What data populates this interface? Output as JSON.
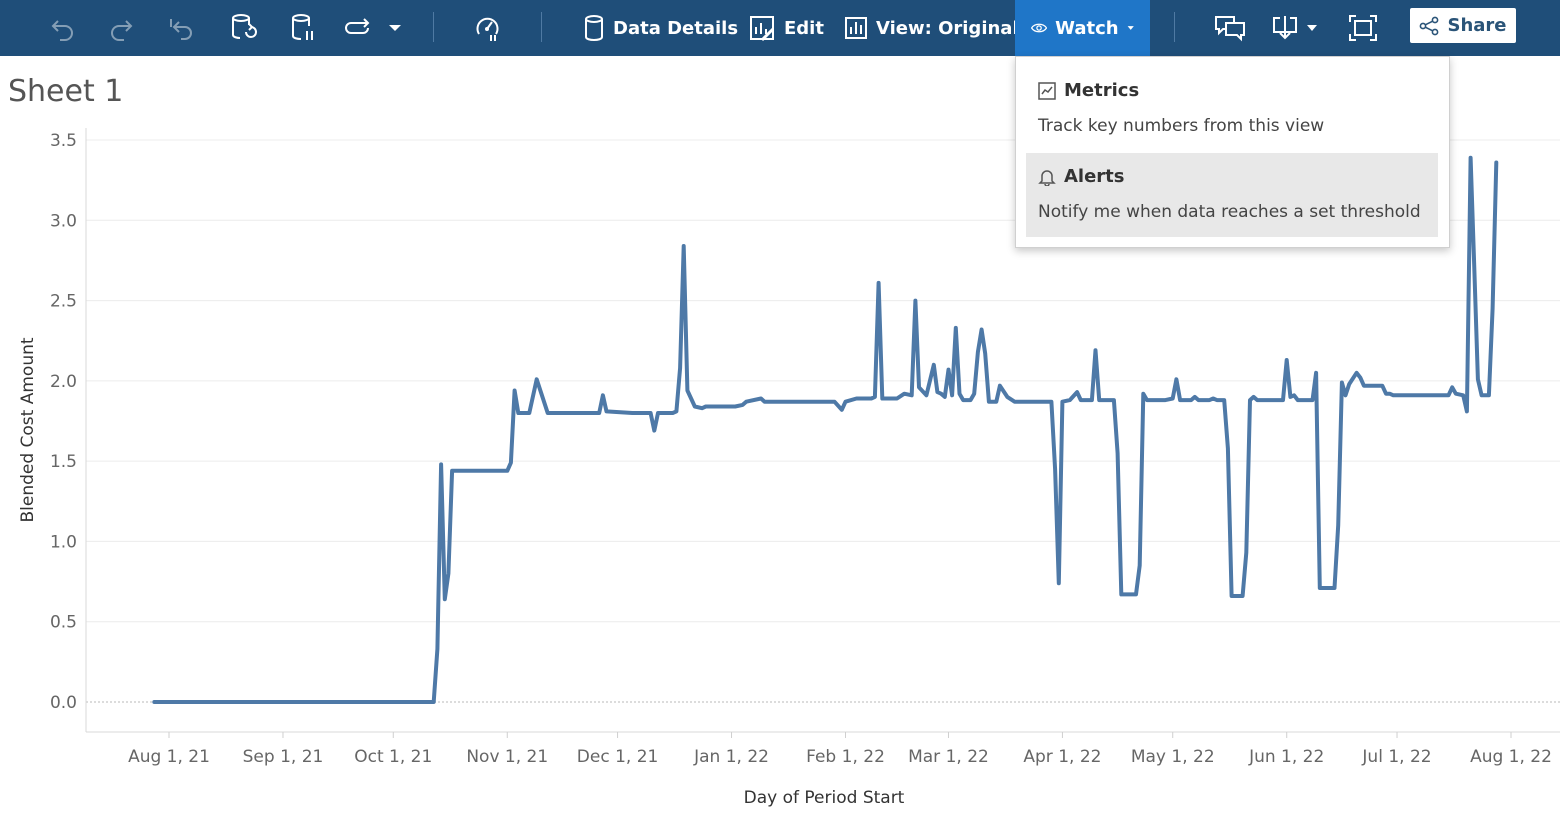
{
  "toolbar": {
    "data_details": "Data Details",
    "edit": "Edit",
    "view": "View: Original",
    "watch": "Watch",
    "share": "Share"
  },
  "sheet": {
    "title": "Sheet 1"
  },
  "watch_menu": {
    "items": [
      {
        "label": "Metrics",
        "description": "Track key numbers from this view",
        "icon": "metrics-icon"
      },
      {
        "label": "Alerts",
        "description": "Notify me when data reaches a set threshold",
        "icon": "bell-icon"
      }
    ]
  },
  "colors": {
    "toolbar": "#1f4e79",
    "watch_active": "#1f76c8",
    "line": "#4e79a7"
  },
  "chart_data": {
    "type": "line",
    "xlabel": "Day of Period Start",
    "ylabel": "Blended Cost Amount",
    "ylim": [
      0,
      3.5
    ],
    "yticks": [
      "0.0",
      "0.5",
      "1.0",
      "1.5",
      "2.0",
      "2.5",
      "3.0",
      "3.5"
    ],
    "xticks": [
      {
        "label": "Aug 1, 21",
        "date": "2021-08-01"
      },
      {
        "label": "Sep 1, 21",
        "date": "2021-09-01"
      },
      {
        "label": "Oct 1, 21",
        "date": "2021-10-01"
      },
      {
        "label": "Nov 1, 21",
        "date": "2021-11-01"
      },
      {
        "label": "Dec 1, 21",
        "date": "2021-12-01"
      },
      {
        "label": "Jan 1, 22",
        "date": "2022-01-01"
      },
      {
        "label": "Feb 1, 22",
        "date": "2022-02-01"
      },
      {
        "label": "Mar 1, 22",
        "date": "2022-03-01"
      },
      {
        "label": "Apr 1, 22",
        "date": "2022-04-01"
      },
      {
        "label": "May 1, 22",
        "date": "2022-05-01"
      },
      {
        "label": "Jun 1, 22",
        "date": "2022-06-01"
      },
      {
        "label": "Jul 1, 22",
        "date": "2022-07-01"
      },
      {
        "label": "Aug 1, 22",
        "date": "2022-08-01"
      }
    ],
    "grid": true,
    "series": [
      {
        "points": [
          [
            "2021-07-28",
            0.0
          ],
          [
            "2021-10-12",
            0.0
          ],
          [
            "2021-10-13",
            0.33
          ],
          [
            "2021-10-14",
            1.48
          ],
          [
            "2021-10-15",
            0.64
          ],
          [
            "2021-10-16",
            0.8
          ],
          [
            "2021-10-17",
            1.44
          ],
          [
            "2021-10-20",
            1.44
          ],
          [
            "2021-11-01",
            1.44
          ],
          [
            "2021-11-02",
            1.49
          ],
          [
            "2021-11-03",
            1.94
          ],
          [
            "2021-11-04",
            1.8
          ],
          [
            "2021-11-07",
            1.8
          ],
          [
            "2021-11-09",
            2.01
          ],
          [
            "2021-11-12",
            1.8
          ],
          [
            "2021-11-22",
            1.8
          ],
          [
            "2021-11-26",
            1.8
          ],
          [
            "2021-11-27",
            1.91
          ],
          [
            "2021-11-28",
            1.81
          ],
          [
            "2021-12-05",
            1.8
          ],
          [
            "2021-12-10",
            1.8
          ],
          [
            "2021-12-11",
            1.69
          ],
          [
            "2021-12-12",
            1.8
          ],
          [
            "2021-12-16",
            1.8
          ],
          [
            "2021-12-17",
            1.81
          ],
          [
            "2021-12-18",
            2.08
          ],
          [
            "2021-12-19",
            2.84
          ],
          [
            "2021-12-20",
            1.94
          ],
          [
            "2021-12-22",
            1.84
          ],
          [
            "2021-12-24",
            1.83
          ],
          [
            "2021-12-25",
            1.84
          ],
          [
            "2022-01-02",
            1.84
          ],
          [
            "2022-01-04",
            1.85
          ],
          [
            "2022-01-05",
            1.87
          ],
          [
            "2022-01-09",
            1.89
          ],
          [
            "2022-01-10",
            1.87
          ],
          [
            "2022-01-28",
            1.87
          ],
          [
            "2022-01-29",
            1.87
          ],
          [
            "2022-01-31",
            1.82
          ],
          [
            "2022-02-01",
            1.87
          ],
          [
            "2022-02-04",
            1.89
          ],
          [
            "2022-02-08",
            1.89
          ],
          [
            "2022-02-09",
            1.9
          ],
          [
            "2022-02-10",
            2.61
          ],
          [
            "2022-02-11",
            1.89
          ],
          [
            "2022-02-15",
            1.89
          ],
          [
            "2022-02-17",
            1.92
          ],
          [
            "2022-02-19",
            1.91
          ],
          [
            "2022-02-20",
            2.5
          ],
          [
            "2022-02-21",
            1.96
          ],
          [
            "2022-02-23",
            1.91
          ],
          [
            "2022-02-25",
            2.1
          ],
          [
            "2022-02-26",
            1.93
          ],
          [
            "2022-02-27",
            1.92
          ],
          [
            "2022-02-28",
            1.9
          ],
          [
            "2022-03-01",
            2.07
          ],
          [
            "2022-03-02",
            1.91
          ],
          [
            "2022-03-03",
            2.33
          ],
          [
            "2022-03-04",
            1.92
          ],
          [
            "2022-03-05",
            1.88
          ],
          [
            "2022-03-07",
            1.88
          ],
          [
            "2022-03-08",
            1.92
          ],
          [
            "2022-03-09",
            2.18
          ],
          [
            "2022-03-10",
            2.32
          ],
          [
            "2022-03-11",
            2.17
          ],
          [
            "2022-03-12",
            1.87
          ],
          [
            "2022-03-14",
            1.87
          ],
          [
            "2022-03-15",
            1.97
          ],
          [
            "2022-03-17",
            1.9
          ],
          [
            "2022-03-19",
            1.87
          ],
          [
            "2022-03-29",
            1.87
          ],
          [
            "2022-03-30",
            1.45
          ],
          [
            "2022-03-31",
            0.74
          ],
          [
            "2022-04-01",
            1.87
          ],
          [
            "2022-04-03",
            1.88
          ],
          [
            "2022-04-05",
            1.93
          ],
          [
            "2022-04-06",
            1.88
          ],
          [
            "2022-04-09",
            1.88
          ],
          [
            "2022-04-10",
            2.19
          ],
          [
            "2022-04-11",
            1.88
          ],
          [
            "2022-04-15",
            1.88
          ],
          [
            "2022-04-16",
            1.55
          ],
          [
            "2022-04-17",
            0.67
          ],
          [
            "2022-04-20",
            0.67
          ],
          [
            "2022-04-21",
            0.67
          ],
          [
            "2022-04-22",
            0.85
          ],
          [
            "2022-04-23",
            1.92
          ],
          [
            "2022-04-24",
            1.88
          ],
          [
            "2022-04-29",
            1.88
          ],
          [
            "2022-05-01",
            1.89
          ],
          [
            "2022-05-02",
            2.01
          ],
          [
            "2022-05-03",
            1.88
          ],
          [
            "2022-05-06",
            1.88
          ],
          [
            "2022-05-07",
            1.9
          ],
          [
            "2022-05-08",
            1.88
          ],
          [
            "2022-05-11",
            1.88
          ],
          [
            "2022-05-12",
            1.89
          ],
          [
            "2022-05-13",
            1.88
          ],
          [
            "2022-05-15",
            1.88
          ],
          [
            "2022-05-16",
            1.58
          ],
          [
            "2022-05-17",
            0.66
          ],
          [
            "2022-05-20",
            0.66
          ],
          [
            "2022-05-21",
            0.93
          ],
          [
            "2022-05-22",
            1.88
          ],
          [
            "2022-05-23",
            1.9
          ],
          [
            "2022-05-24",
            1.88
          ],
          [
            "2022-05-31",
            1.88
          ],
          [
            "2022-06-01",
            2.13
          ],
          [
            "2022-06-02",
            1.9
          ],
          [
            "2022-06-03",
            1.91
          ],
          [
            "2022-06-04",
            1.88
          ],
          [
            "2022-06-08",
            1.88
          ],
          [
            "2022-06-09",
            2.05
          ],
          [
            "2022-06-10",
            0.71
          ],
          [
            "2022-06-14",
            0.71
          ],
          [
            "2022-06-15",
            1.1
          ],
          [
            "2022-06-16",
            1.99
          ],
          [
            "2022-06-17",
            1.91
          ],
          [
            "2022-06-18",
            1.98
          ],
          [
            "2022-06-20",
            2.05
          ],
          [
            "2022-06-21",
            2.02
          ],
          [
            "2022-06-22",
            1.97
          ],
          [
            "2022-06-27",
            1.97
          ],
          [
            "2022-06-28",
            1.92
          ],
          [
            "2022-06-29",
            1.92
          ],
          [
            "2022-06-30",
            1.91
          ],
          [
            "2022-07-15",
            1.91
          ],
          [
            "2022-07-16",
            1.96
          ],
          [
            "2022-07-17",
            1.92
          ],
          [
            "2022-07-19",
            1.91
          ],
          [
            "2022-07-20",
            1.81
          ],
          [
            "2022-07-21",
            3.39
          ],
          [
            "2022-07-22",
            2.72
          ],
          [
            "2022-07-23",
            2.01
          ],
          [
            "2022-07-24",
            1.91
          ],
          [
            "2022-07-26",
            1.91
          ],
          [
            "2022-07-27",
            2.45
          ],
          [
            "2022-07-28",
            3.36
          ]
        ]
      }
    ]
  }
}
